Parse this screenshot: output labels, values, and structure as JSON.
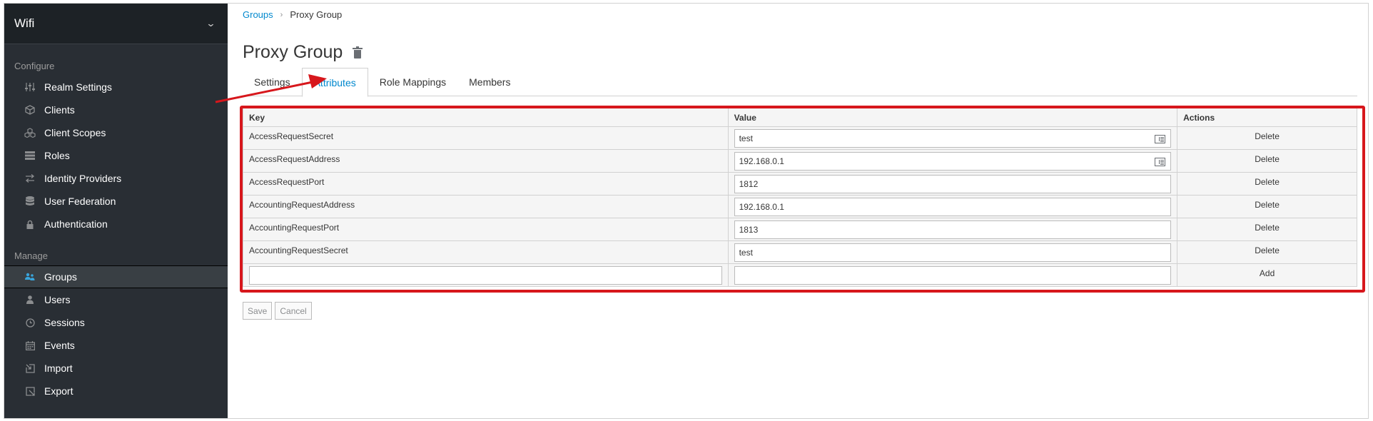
{
  "sidebar": {
    "realm_name": "Wifi",
    "configure_label": "Configure",
    "configure_items": [
      {
        "label": "Realm Settings",
        "icon": "sliders-icon"
      },
      {
        "label": "Clients",
        "icon": "cube-icon"
      },
      {
        "label": "Client Scopes",
        "icon": "cubes-icon"
      },
      {
        "label": "Roles",
        "icon": "list-icon"
      },
      {
        "label": "Identity Providers",
        "icon": "exchange-icon"
      },
      {
        "label": "User Federation",
        "icon": "database-icon"
      },
      {
        "label": "Authentication",
        "icon": "lock-icon"
      }
    ],
    "manage_label": "Manage",
    "manage_items": [
      {
        "label": "Groups",
        "icon": "users-icon",
        "active": true
      },
      {
        "label": "Users",
        "icon": "user-icon"
      },
      {
        "label": "Sessions",
        "icon": "clock-icon"
      },
      {
        "label": "Events",
        "icon": "calendar-icon"
      },
      {
        "label": "Import",
        "icon": "import-icon"
      },
      {
        "label": "Export",
        "icon": "export-icon"
      }
    ]
  },
  "breadcrumb": {
    "parent": "Groups",
    "current": "Proxy Group"
  },
  "page": {
    "title": "Proxy Group"
  },
  "tabs": [
    {
      "label": "Settings",
      "active": false
    },
    {
      "label": "Attributes",
      "active": true
    },
    {
      "label": "Role Mappings",
      "active": false
    },
    {
      "label": "Members",
      "active": false
    }
  ],
  "table": {
    "headers": {
      "key": "Key",
      "value": "Value",
      "actions": "Actions"
    },
    "rows": [
      {
        "key": "AccessRequestSecret",
        "value": "test",
        "action": "Delete",
        "keyboard_icon": true
      },
      {
        "key": "AccessRequestAddress",
        "value": "192.168.0.1",
        "action": "Delete",
        "keyboard_icon": true
      },
      {
        "key": "AccessRequestPort",
        "value": "1812",
        "action": "Delete",
        "keyboard_icon": false
      },
      {
        "key": "AccountingRequestAddress",
        "value": "192.168.0.1",
        "action": "Delete",
        "keyboard_icon": false
      },
      {
        "key": "AccountingRequestPort",
        "value": "1813",
        "action": "Delete",
        "keyboard_icon": false
      },
      {
        "key": "AccountingRequestSecret",
        "value": "test",
        "action": "Delete",
        "keyboard_icon": false
      }
    ],
    "new_row": {
      "key": "",
      "value": "",
      "action": "Add"
    }
  },
  "buttons": {
    "save": "Save",
    "cancel": "Cancel"
  },
  "colors": {
    "sidebar_bg": "#292e34",
    "accent": "#0088ce",
    "annotation": "#d7171c"
  }
}
